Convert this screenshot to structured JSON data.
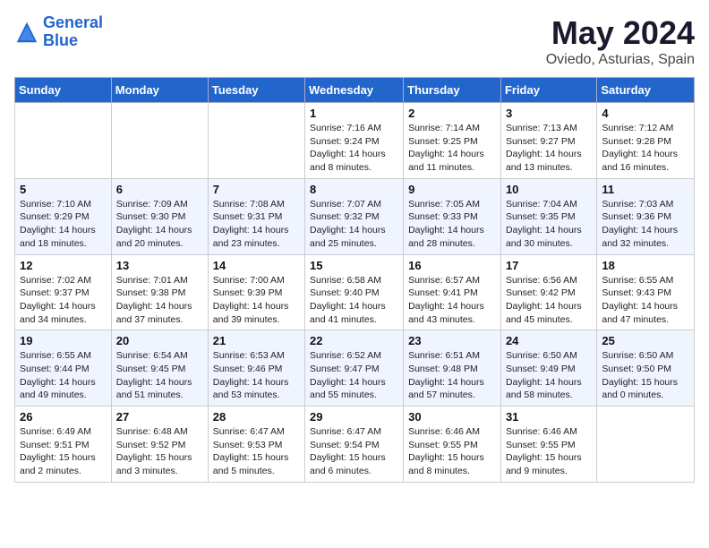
{
  "logo": {
    "line1": "General",
    "line2": "Blue"
  },
  "header": {
    "month": "May 2024",
    "location": "Oviedo, Asturias, Spain"
  },
  "weekdays": [
    "Sunday",
    "Monday",
    "Tuesday",
    "Wednesday",
    "Thursday",
    "Friday",
    "Saturday"
  ],
  "weeks": [
    [
      {
        "day": "",
        "sunrise": "",
        "sunset": "",
        "daylight": ""
      },
      {
        "day": "",
        "sunrise": "",
        "sunset": "",
        "daylight": ""
      },
      {
        "day": "",
        "sunrise": "",
        "sunset": "",
        "daylight": ""
      },
      {
        "day": "1",
        "sunrise": "Sunrise: 7:16 AM",
        "sunset": "Sunset: 9:24 PM",
        "daylight": "Daylight: 14 hours and 8 minutes."
      },
      {
        "day": "2",
        "sunrise": "Sunrise: 7:14 AM",
        "sunset": "Sunset: 9:25 PM",
        "daylight": "Daylight: 14 hours and 11 minutes."
      },
      {
        "day": "3",
        "sunrise": "Sunrise: 7:13 AM",
        "sunset": "Sunset: 9:27 PM",
        "daylight": "Daylight: 14 hours and 13 minutes."
      },
      {
        "day": "4",
        "sunrise": "Sunrise: 7:12 AM",
        "sunset": "Sunset: 9:28 PM",
        "daylight": "Daylight: 14 hours and 16 minutes."
      }
    ],
    [
      {
        "day": "5",
        "sunrise": "Sunrise: 7:10 AM",
        "sunset": "Sunset: 9:29 PM",
        "daylight": "Daylight: 14 hours and 18 minutes."
      },
      {
        "day": "6",
        "sunrise": "Sunrise: 7:09 AM",
        "sunset": "Sunset: 9:30 PM",
        "daylight": "Daylight: 14 hours and 20 minutes."
      },
      {
        "day": "7",
        "sunrise": "Sunrise: 7:08 AM",
        "sunset": "Sunset: 9:31 PM",
        "daylight": "Daylight: 14 hours and 23 minutes."
      },
      {
        "day": "8",
        "sunrise": "Sunrise: 7:07 AM",
        "sunset": "Sunset: 9:32 PM",
        "daylight": "Daylight: 14 hours and 25 minutes."
      },
      {
        "day": "9",
        "sunrise": "Sunrise: 7:05 AM",
        "sunset": "Sunset: 9:33 PM",
        "daylight": "Daylight: 14 hours and 28 minutes."
      },
      {
        "day": "10",
        "sunrise": "Sunrise: 7:04 AM",
        "sunset": "Sunset: 9:35 PM",
        "daylight": "Daylight: 14 hours and 30 minutes."
      },
      {
        "day": "11",
        "sunrise": "Sunrise: 7:03 AM",
        "sunset": "Sunset: 9:36 PM",
        "daylight": "Daylight: 14 hours and 32 minutes."
      }
    ],
    [
      {
        "day": "12",
        "sunrise": "Sunrise: 7:02 AM",
        "sunset": "Sunset: 9:37 PM",
        "daylight": "Daylight: 14 hours and 34 minutes."
      },
      {
        "day": "13",
        "sunrise": "Sunrise: 7:01 AM",
        "sunset": "Sunset: 9:38 PM",
        "daylight": "Daylight: 14 hours and 37 minutes."
      },
      {
        "day": "14",
        "sunrise": "Sunrise: 7:00 AM",
        "sunset": "Sunset: 9:39 PM",
        "daylight": "Daylight: 14 hours and 39 minutes."
      },
      {
        "day": "15",
        "sunrise": "Sunrise: 6:58 AM",
        "sunset": "Sunset: 9:40 PM",
        "daylight": "Daylight: 14 hours and 41 minutes."
      },
      {
        "day": "16",
        "sunrise": "Sunrise: 6:57 AM",
        "sunset": "Sunset: 9:41 PM",
        "daylight": "Daylight: 14 hours and 43 minutes."
      },
      {
        "day": "17",
        "sunrise": "Sunrise: 6:56 AM",
        "sunset": "Sunset: 9:42 PM",
        "daylight": "Daylight: 14 hours and 45 minutes."
      },
      {
        "day": "18",
        "sunrise": "Sunrise: 6:55 AM",
        "sunset": "Sunset: 9:43 PM",
        "daylight": "Daylight: 14 hours and 47 minutes."
      }
    ],
    [
      {
        "day": "19",
        "sunrise": "Sunrise: 6:55 AM",
        "sunset": "Sunset: 9:44 PM",
        "daylight": "Daylight: 14 hours and 49 minutes."
      },
      {
        "day": "20",
        "sunrise": "Sunrise: 6:54 AM",
        "sunset": "Sunset: 9:45 PM",
        "daylight": "Daylight: 14 hours and 51 minutes."
      },
      {
        "day": "21",
        "sunrise": "Sunrise: 6:53 AM",
        "sunset": "Sunset: 9:46 PM",
        "daylight": "Daylight: 14 hours and 53 minutes."
      },
      {
        "day": "22",
        "sunrise": "Sunrise: 6:52 AM",
        "sunset": "Sunset: 9:47 PM",
        "daylight": "Daylight: 14 hours and 55 minutes."
      },
      {
        "day": "23",
        "sunrise": "Sunrise: 6:51 AM",
        "sunset": "Sunset: 9:48 PM",
        "daylight": "Daylight: 14 hours and 57 minutes."
      },
      {
        "day": "24",
        "sunrise": "Sunrise: 6:50 AM",
        "sunset": "Sunset: 9:49 PM",
        "daylight": "Daylight: 14 hours and 58 minutes."
      },
      {
        "day": "25",
        "sunrise": "Sunrise: 6:50 AM",
        "sunset": "Sunset: 9:50 PM",
        "daylight": "Daylight: 15 hours and 0 minutes."
      }
    ],
    [
      {
        "day": "26",
        "sunrise": "Sunrise: 6:49 AM",
        "sunset": "Sunset: 9:51 PM",
        "daylight": "Daylight: 15 hours and 2 minutes."
      },
      {
        "day": "27",
        "sunrise": "Sunrise: 6:48 AM",
        "sunset": "Sunset: 9:52 PM",
        "daylight": "Daylight: 15 hours and 3 minutes."
      },
      {
        "day": "28",
        "sunrise": "Sunrise: 6:47 AM",
        "sunset": "Sunset: 9:53 PM",
        "daylight": "Daylight: 15 hours and 5 minutes."
      },
      {
        "day": "29",
        "sunrise": "Sunrise: 6:47 AM",
        "sunset": "Sunset: 9:54 PM",
        "daylight": "Daylight: 15 hours and 6 minutes."
      },
      {
        "day": "30",
        "sunrise": "Sunrise: 6:46 AM",
        "sunset": "Sunset: 9:55 PM",
        "daylight": "Daylight: 15 hours and 8 minutes."
      },
      {
        "day": "31",
        "sunrise": "Sunrise: 6:46 AM",
        "sunset": "Sunset: 9:55 PM",
        "daylight": "Daylight: 15 hours and 9 minutes."
      },
      {
        "day": "",
        "sunrise": "",
        "sunset": "",
        "daylight": ""
      }
    ]
  ]
}
